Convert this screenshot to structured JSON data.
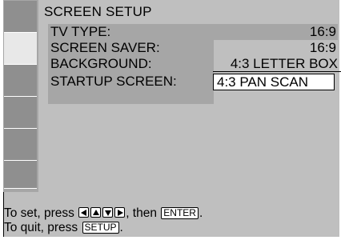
{
  "menu": {
    "title": "SCREEN SETUP",
    "items": [
      {
        "label": "TV TYPE:",
        "value": "16:9"
      },
      {
        "label": "SCREEN SAVER:",
        "value": "16:9"
      },
      {
        "label": "BACKGROUND:",
        "value": "4:3 LETTER BOX"
      },
      {
        "label": "STARTUP SCREEN:",
        "value": "4:3 PAN SCAN"
      }
    ]
  },
  "footer": {
    "set_prefix": "To set, press",
    "set_then": ", then",
    "enter_key": "ENTER",
    "set_end": ".",
    "quit_prefix": "To quit, press",
    "setup_key": "SETUP",
    "quit_end": "."
  },
  "icons": [
    "setup-category-icon",
    "screen-setup-icon",
    "setup-category-icon",
    "setup-category-icon",
    "setup-category-icon",
    "setup-category-icon"
  ],
  "colors": {
    "panel": "#bfbfbf",
    "highlight": "#a6a6a6",
    "sidebar": "#8f8f8f",
    "selected": "#e8e8e8"
  }
}
